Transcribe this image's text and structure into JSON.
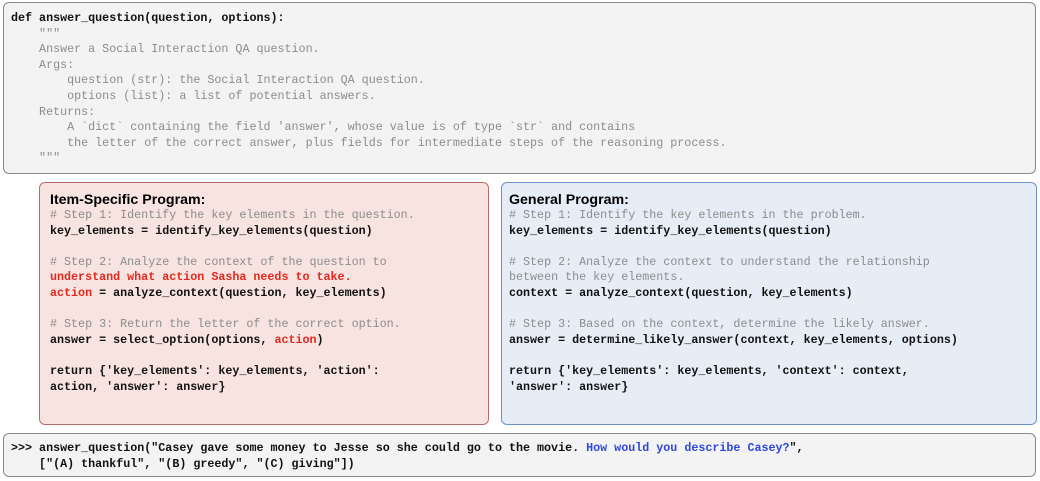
{
  "top": {
    "sig": "def answer_question(question, options):",
    "doc_open": "    \"\"\"",
    "doc": [
      "    Answer a Social Interaction QA question.",
      "    Args:",
      "        question (str): the Social Interaction QA question.",
      "        options (list): a list of potential answers.",
      "    Returns:",
      "        A `dict` containing the field 'answer', whose value is of type `str` and contains",
      "        the letter of the correct answer, plus fields for intermediate steps of the reasoning process."
    ],
    "doc_close": "    \"\"\""
  },
  "item": {
    "title": "Item-Specific Program:",
    "s1_comment": "# Step 1: Identify the key elements in the question.",
    "s1_code": "key_elements = identify_key_elements(question)",
    "s2_comment": "# Step 2: Analyze the context of the question to",
    "s2_red": "understand what action Sasha needs to take.",
    "s2_var": "action",
    "s2_rest": " = analyze_context(question, key_elements)",
    "s3_comment": "# Step 3: Return the letter of the correct option.",
    "s3_pre": "answer = select_option(options, ",
    "s3_var": "action",
    "s3_post": ")",
    "ret1": "return {'key_elements': key_elements, 'action':",
    "ret2": "action, 'answer': answer}"
  },
  "general": {
    "title": "General Program:",
    "s1_comment": "# Step 1: Identify the key elements in the problem.",
    "s1_code": "key_elements = identify_key_elements(question)",
    "s2_comment1": "# Step 2: Analyze the context to understand the relationship",
    "s2_comment2": "between the key elements.",
    "s2_code": "context = analyze_context(question, key_elements)",
    "s3_comment": "# Step 3: Based on the context, determine the likely answer.",
    "s3_code": "answer = determine_likely_answer(context, key_elements, options)",
    "ret1": "return {'key_elements': key_elements, 'context': context,",
    "ret2": "'answer': answer}"
  },
  "call": {
    "pre": ">>> answer_question(\"Casey gave some money to Jesse so she could go to the movie. ",
    "question": "How would you describe Casey?",
    "post": "\",",
    "options_line": "    [\"(A) thankful\", \"(B) greedy\", \"(C) giving\"])"
  }
}
